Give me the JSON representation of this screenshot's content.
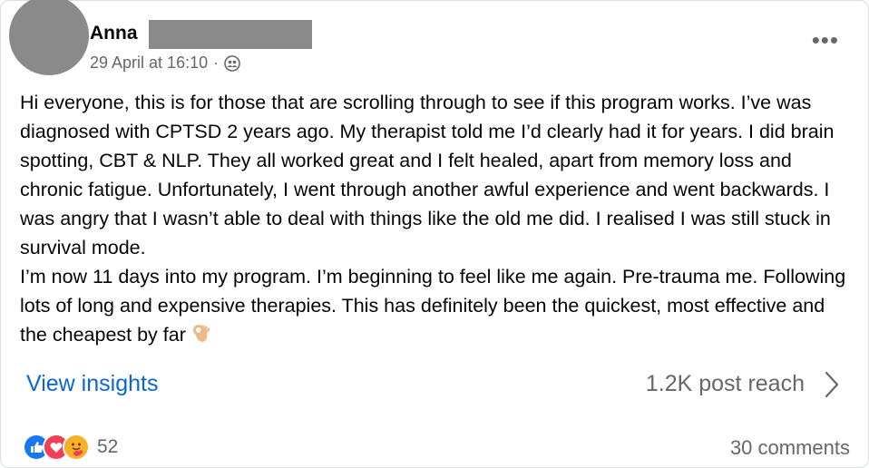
{
  "post": {
    "author_first": "Anna",
    "timestamp": "29 April at 16:10",
    "separator": "·",
    "audience_icon": "friends-icon",
    "more_label": "•••",
    "paragraphs": [
      "Hi everyone, this is for those that are scrolling through to see if this program works. I’ve was diagnosed with CPTSD 2 years ago. My therapist told me I’d clearly had it for years. I did brain spotting, CBT & NLP. They all worked great and I felt healed, apart from memory loss and chronic fatigue. Unfortunately, I went through another awful experience and went backwards. I was angry that I wasn’t able to deal with things like the old me did. I realised I was still stuck in survival mode.",
      "I’m now 11 days into my program. I’m beginning to feel like me again. Pre-trauma me. Following lots of long and expensive therapies. This has definitely been the quickest, most effective and the cheapest by far"
    ],
    "ending_emoji": "ok-hand-emoji"
  },
  "insights": {
    "link_label": "View insights",
    "reach_label": "1.2K post reach"
  },
  "footer": {
    "reactions": [
      "like-reaction",
      "love-reaction",
      "care-reaction"
    ],
    "reaction_count": "52",
    "comments_label": "30 comments"
  },
  "colors": {
    "link": "#0a66d8",
    "secondary_text": "#65676b",
    "like": "#1877f2",
    "love": "#f33e58",
    "care": "#f7b125"
  }
}
